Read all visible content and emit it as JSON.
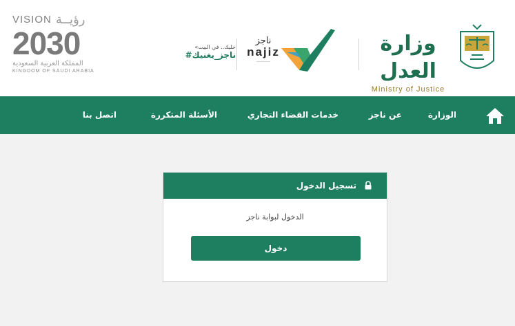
{
  "header": {
    "vision": {
      "word": "VISION",
      "arabic": "رؤيــة",
      "year": "2030",
      "country_ar": "المملكة العربية السعودية",
      "country_en": "KINGDOM OF SAUDI ARABIA"
    },
    "najiz_tagline": {
      "small": "«خليك.. في البيت",
      "hashtag": "#ناجز_يغنيك"
    },
    "najiz_logo": {
      "arabic": "ناجز",
      "latin": "najiz"
    },
    "ministry": {
      "arabic": "وزارة العدل",
      "english": "Ministry of Justice"
    }
  },
  "nav": {
    "items": [
      {
        "label": "الوزارة"
      },
      {
        "label": "عن ناجز"
      },
      {
        "label": "خدمات القضاء التجاري"
      },
      {
        "label": "الأسئلة المتكررة"
      },
      {
        "label": "اتصل بنا"
      }
    ]
  },
  "login": {
    "title": "تسجيل الدخول",
    "description": "الدخول لبوابة ناجز",
    "button_label": "دخول"
  },
  "colors": {
    "brand_green": "#1e7e60",
    "gold": "#9a7b2a"
  },
  "icons": {
    "home": "home-icon",
    "lock": "lock-icon"
  }
}
